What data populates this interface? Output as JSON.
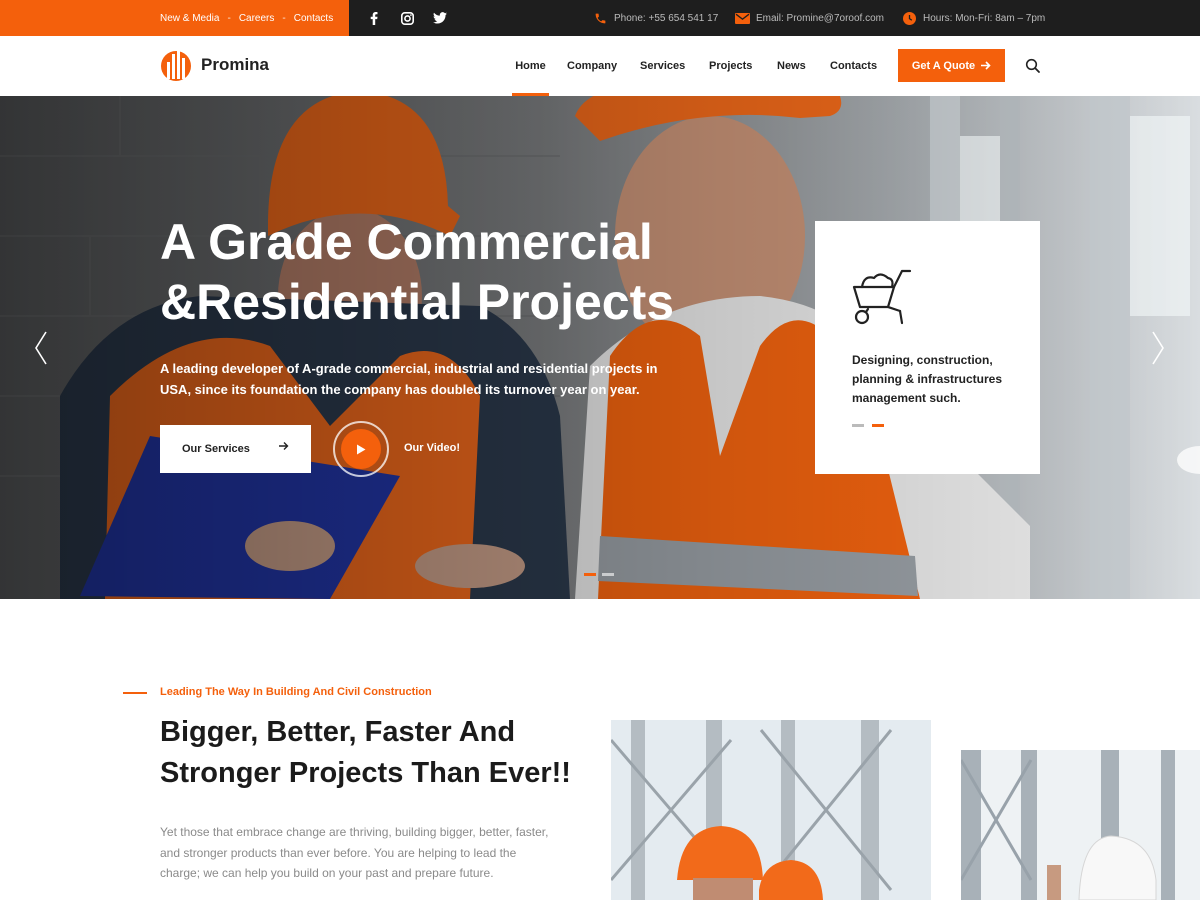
{
  "colors": {
    "accent": "#f4600c",
    "topbar": "#1e1e1e",
    "text": "#222222"
  },
  "topbar": {
    "links": [
      "New & Media",
      "Careers",
      "Contacts"
    ],
    "link_separator": "-",
    "socials": [
      "facebook-icon",
      "instagram-icon",
      "twitter-icon"
    ],
    "phone": "Phone: +55 654 541 17",
    "email": "Email: Promine@7oroof.com",
    "hours": "Hours: Mon-Fri: 8am – 7pm"
  },
  "header": {
    "logo_text": "Promina",
    "nav": [
      "Home",
      "Company",
      "Services",
      "Projects",
      "News",
      "Contacts"
    ],
    "active_nav": "Home",
    "cta_label": "Get A Quote",
    "search_icon": "search-icon"
  },
  "hero": {
    "title_lines": [
      "A Grade Commercial",
      "&Residential Projects"
    ],
    "description": "A leading developer of A-grade commercial, industrial and residential projects in USA, since its foundation the company has doubled its turnover year on year.",
    "services_button": "Our Services",
    "video_label": "Our Video!",
    "card_icon": "wheelbarrow-icon",
    "card_text": "Designing, construction, planning & infrastructures management such."
  },
  "about": {
    "tagline": "Leading The Way In Building And Civil Construction",
    "title_lines": [
      "Bigger, Better, Faster And",
      "Stronger Projects Than Ever!!"
    ],
    "text_lines": [
      "Yet those that embrace change are thriving, building bigger, better, faster,",
      "and stronger products than ever before. You are helping to lead the",
      "charge; we can help you build on your past and prepare future."
    ]
  }
}
